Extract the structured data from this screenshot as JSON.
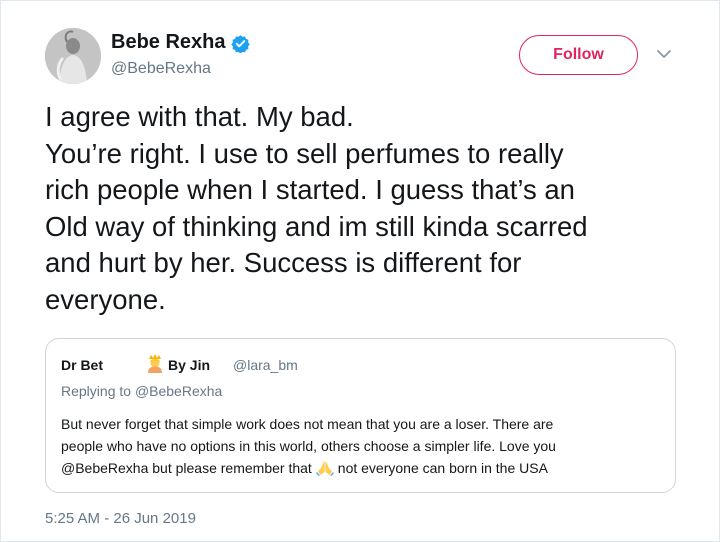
{
  "author": {
    "name": "Bebe Rexha",
    "handle": "@BebeRexha",
    "verified": true
  },
  "follow_button": {
    "label": "Follow"
  },
  "tweet": {
    "lines": [
      "I agree with that. My bad.",
      "You’re right. I use to sell perfumes to really",
      "rich people when I started. I guess that’s an",
      "Old way of thinking and im still kinda scarred",
      "and hurt by her. Success is different for",
      "everyone."
    ],
    "timestamp": "5:25 AM - 26 Jun 2019"
  },
  "quoted_tweet": {
    "name_part1": "Dr Bet",
    "name_part2": "By Jin",
    "handle": "@lara_bm",
    "replying_prefix": "Replying to",
    "replying_to": "@BebeRexha",
    "lines": [
      "But never forget that simple work does not mean that you are a loser. There are",
      "people who have no options in this world, others choose a simpler life. Love you"
    ],
    "line3_before_emoji": "@BebeRexha but please remember that",
    "line3_after_emoji": "not everyone can born in the USA"
  },
  "icons": {
    "verified": "verified-badge-icon",
    "chevron": "chevron-down-icon",
    "name_emoji": "person-with-crown-emoji-icon",
    "pray_emoji": "folded-hands-emoji-icon"
  },
  "colors": {
    "follow_accent": "#e0245e",
    "verified_blue": "#1da1f2",
    "muted_text": "#657786",
    "border": "#ccd6dd"
  }
}
